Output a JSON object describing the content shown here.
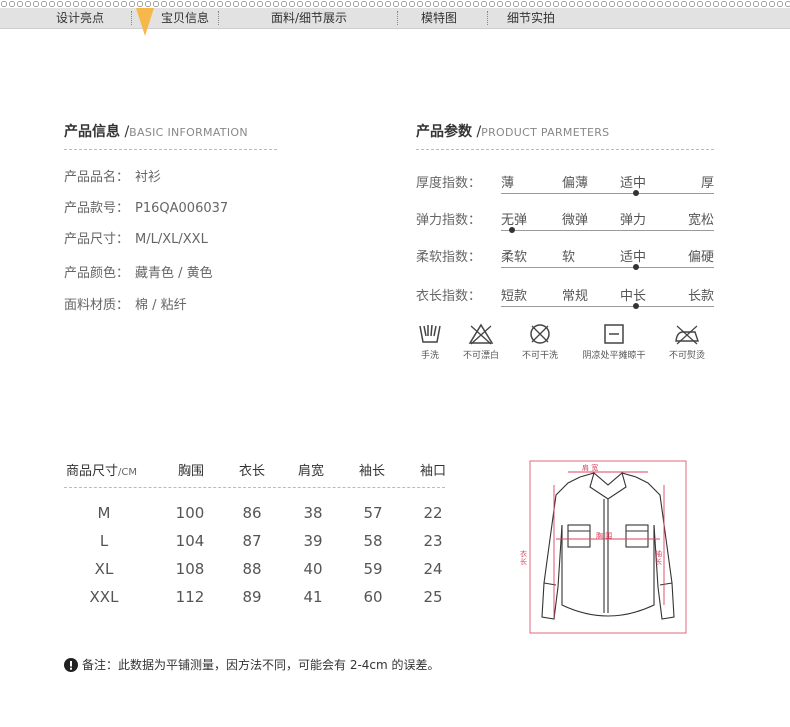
{
  "nav": {
    "items": [
      {
        "label": "设计亮点"
      },
      {
        "label": "宝贝信息"
      },
      {
        "label": "面料/细节展示"
      },
      {
        "label": "模特图"
      },
      {
        "label": "细节实拍"
      }
    ]
  },
  "product_info": {
    "title": "产品信息",
    "title_en": "BASIC INFORMATION",
    "rows": [
      {
        "label": "产品品名：",
        "value": "衬衫"
      },
      {
        "label": "产品款号：",
        "value": "P16QA006037"
      },
      {
        "label": "产品尺寸：",
        "value": "M/L/XL/XXL"
      },
      {
        "label": "产品颜色：",
        "value": "藏青色 / 黄色"
      },
      {
        "label": "面料材质：",
        "value": "棉 / 粘纤"
      }
    ]
  },
  "product_params": {
    "title": "产品参数",
    "title_en": "PRODUCT PARMETERS",
    "rows": [
      {
        "label": "厚度指数：",
        "options": [
          "薄",
          "偏薄",
          "适中",
          "厚"
        ],
        "selected_index": 2
      },
      {
        "label": "弹力指数：",
        "options": [
          "无弹",
          "微弹",
          "弹力",
          "宽松"
        ],
        "selected_index": 0
      },
      {
        "label": "柔软指数：",
        "options": [
          "柔软",
          "软",
          "适中",
          "偏硬"
        ],
        "selected_index": 2
      },
      {
        "label": "衣长指数：",
        "options": [
          "短款",
          "常规",
          "中长",
          "长款"
        ],
        "selected_index": 2
      }
    ]
  },
  "care": [
    {
      "label": "手洗",
      "icon": "hand-wash-icon"
    },
    {
      "label": "不可漂白",
      "icon": "no-bleach-icon"
    },
    {
      "label": "不可干洗",
      "icon": "no-dry-clean-icon"
    },
    {
      "label": "阴凉处平摊晾干",
      "icon": "dry-flat-shade-icon"
    },
    {
      "label": "不可熨烫",
      "icon": "no-iron-icon"
    }
  ],
  "size_table": {
    "headers": [
      "商品尺寸",
      "胸围",
      "衣长",
      "肩宽",
      "袖长",
      "袖口"
    ],
    "unit": "/CM",
    "rows": [
      [
        "M",
        "100",
        "86",
        "38",
        "57",
        "22"
      ],
      [
        "L",
        "104",
        "87",
        "39",
        "58",
        "23"
      ],
      [
        "XL",
        "108",
        "88",
        "40",
        "59",
        "24"
      ],
      [
        "XXL",
        "112",
        "89",
        "41",
        "60",
        "25"
      ]
    ]
  },
  "diagram": {
    "labels": {
      "shoulder": "肩 宽",
      "chest": "胸 围",
      "length": "衣 长",
      "sleeve": "袖 长"
    },
    "accent": "#d9455f"
  },
  "note": "备注：此数据为平铺测量，因方法不同，可能会有 2-4cm 的误差。"
}
